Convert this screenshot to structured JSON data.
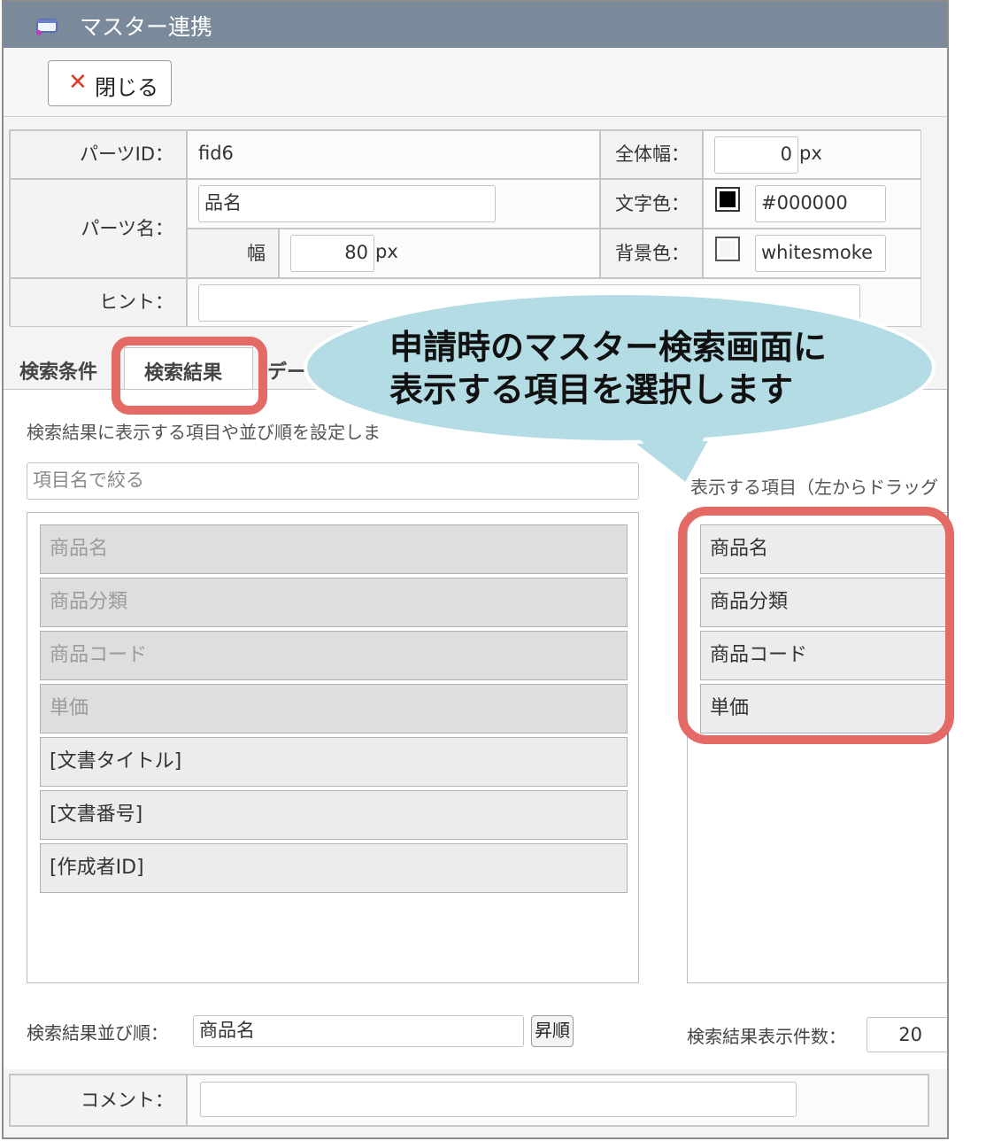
{
  "window": {
    "title": "マスター連携",
    "title_icon": "window-icon"
  },
  "toolbar": {
    "close_icon": "close-x-icon",
    "close_label": "閉じる"
  },
  "form": {
    "parts_id_label": "パーツID：",
    "parts_id_value": "fid6",
    "total_width_label": "全体幅：",
    "total_width_value": "0",
    "px1": "px",
    "parts_name_label": "パーツ名：",
    "parts_name_value": "品名",
    "text_color_label": "文字色：",
    "text_color_value": "#000000",
    "width_label": "幅",
    "width_value": "80",
    "px2": "px",
    "bg_color_label": "背景色：",
    "bg_color_value": "whitesmoke",
    "hint_label": "ヒント：",
    "hint_value": ""
  },
  "tabs": {
    "search_cond": "検索条件",
    "search_result": "検索結果",
    "data_partial": "デー"
  },
  "callout": {
    "line1": "申請時のマスター検索画面に",
    "line2": "表示する項目を選択します"
  },
  "panel": {
    "description": "検索結果に表示する項目や並び順を設定しま",
    "filter_placeholder": "項目名で絞る",
    "right_heading": "表示する項目（左からドラッグ",
    "available_items": [
      "商品名",
      "商品分類",
      "商品コード",
      "単価",
      "[文書タイトル]",
      "[文書番号]",
      "[作成者ID]"
    ],
    "selected_items": [
      "商品名",
      "商品分類",
      "商品コード",
      "単価"
    ],
    "sort_label": "検索結果並び順：",
    "sort_value": "商品名",
    "sort_order": "昇順",
    "count_label": "検索結果表示件数：",
    "count_value": "20"
  },
  "comment": {
    "label": "コメント：",
    "value": ""
  },
  "colors": {
    "titlebar": "#7a8a9a",
    "highlight": "#e46a66",
    "bubble": "#b4dce4",
    "close_x": "#e0392b"
  }
}
